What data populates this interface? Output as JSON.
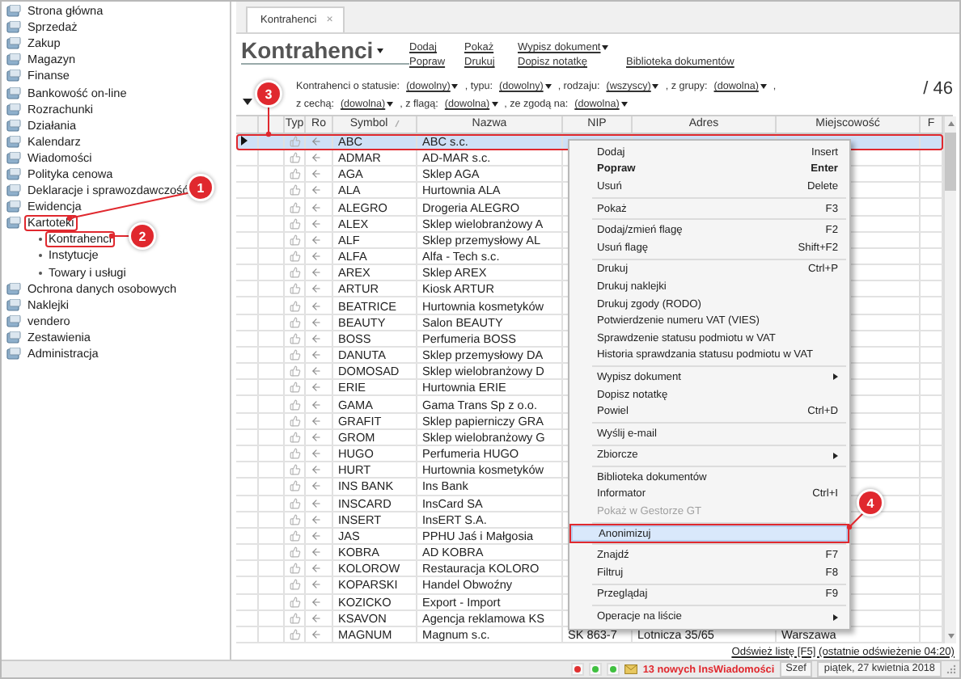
{
  "sidebar": {
    "items": [
      {
        "label": "Strona główna",
        "marked": false
      },
      {
        "label": "Sprzedaż",
        "marked": false
      },
      {
        "label": "Zakup",
        "marked": false
      },
      {
        "label": "Magazyn",
        "marked": false
      },
      {
        "label": "Finanse",
        "marked": false
      },
      {
        "label": "Bankowość on-line",
        "marked": false
      },
      {
        "label": "Rozrachunki",
        "marked": false
      },
      {
        "label": "Działania",
        "marked": false
      },
      {
        "label": "Kalendarz",
        "marked": false
      },
      {
        "label": "Wiadomości",
        "marked": false
      },
      {
        "label": "Polityka cenowa",
        "marked": false
      },
      {
        "label": "Deklaracje i sprawozdawczość",
        "marked": false
      },
      {
        "label": "Ewidencja",
        "marked": false
      },
      {
        "label": "Kartoteki",
        "marked": true,
        "expanded": true,
        "children": [
          {
            "label": "Kontrahenci",
            "marked": true
          },
          {
            "label": "Instytucje",
            "marked": false
          },
          {
            "label": "Towary i usługi",
            "marked": false
          }
        ]
      },
      {
        "label": "Ochrona danych osobowych",
        "marked": false
      },
      {
        "label": "Naklejki",
        "marked": false
      },
      {
        "label": "vendero",
        "marked": false
      },
      {
        "label": "Zestawienia",
        "marked": false
      },
      {
        "label": "Administracja",
        "marked": false
      }
    ]
  },
  "tab": {
    "label": "Kontrahenci",
    "close": "×"
  },
  "header": {
    "title": "Kontrahenci",
    "links": [
      {
        "label": "Dodaj",
        "dropdown": false
      },
      {
        "label": "Popraw",
        "dropdown": false
      },
      {
        "label": "Pokaż",
        "dropdown": false
      },
      {
        "label": "Drukuj",
        "dropdown": false
      },
      {
        "label": "Wypisz dokument",
        "dropdown": true
      },
      {
        "label": "Dopisz notatkę",
        "dropdown": false
      },
      {
        "label": "Biblioteka dokumentów",
        "dropdown": false
      }
    ]
  },
  "filters": [
    [
      {
        "text": "Kontrahenci o statusie:",
        "value": "(dowolny)"
      },
      {
        "text": ", typu:",
        "value": "(dowolny)"
      },
      {
        "text": ", rodzaju:",
        "value": "(wszyscy)"
      },
      {
        "text": ", z grupy:",
        "value": "(dowolna)"
      },
      {
        "text": ","
      }
    ],
    [
      {
        "text": "z cechą:",
        "value": "(dowolna)"
      },
      {
        "text": ", z flagą:",
        "value": "(dowolna)"
      },
      {
        "text": ", ze zgodą na:",
        "value": "(dowolna)"
      }
    ]
  ],
  "count": "/ 46",
  "table": {
    "columns": [
      "",
      "",
      "Typ",
      "Ro",
      "Symbol",
      "Nazwa",
      "NIP",
      "Adres",
      "Miejscowość",
      "F"
    ],
    "rows": [
      {
        "symbol": "ABC",
        "name": "ABC s.c.",
        "selected": true,
        "marked": true
      },
      {
        "symbol": "ADMAR",
        "name": "AD-MAR s.c.",
        "selected": false,
        "marked": false
      },
      {
        "symbol": "AGA",
        "name": "Sklep AGA",
        "selected": false,
        "marked": false
      },
      {
        "symbol": "ALA",
        "name": "Hurtownia ALA",
        "selected": false,
        "marked": false
      },
      {
        "symbol": "ALEGRO",
        "name": "Drogeria ALEGRO",
        "selected": false,
        "marked": false
      },
      {
        "symbol": "ALEX",
        "name": "Sklep wielobranżowy  A",
        "selected": false,
        "marked": false
      },
      {
        "symbol": "ALF",
        "name": "Sklep przemysłowy AL",
        "selected": false,
        "marked": false
      },
      {
        "symbol": "ALFA",
        "name": "Alfa - Tech s.c.",
        "selected": false,
        "marked": false
      },
      {
        "symbol": "AREX",
        "name": "Sklep AREX",
        "selected": false,
        "marked": false
      },
      {
        "symbol": "ARTUR",
        "name": "Kiosk ARTUR",
        "selected": false,
        "marked": false
      },
      {
        "symbol": "BEATRICE",
        "name": "Hurtownia kosmetyków",
        "selected": false,
        "marked": false
      },
      {
        "symbol": "BEAUTY",
        "name": "Salon BEAUTY",
        "selected": false,
        "marked": false
      },
      {
        "symbol": "BOSS",
        "name": "Perfumeria BOSS",
        "selected": false,
        "marked": false
      },
      {
        "symbol": "DANUTA",
        "name": "Sklep przemysłowy DA",
        "selected": false,
        "marked": false
      },
      {
        "symbol": "DOMOSAD",
        "name": "Sklep wielobranżowy D",
        "selected": false,
        "marked": false
      },
      {
        "symbol": "ERIE",
        "name": "Hurtownia ERIE",
        "selected": false,
        "marked": false
      },
      {
        "symbol": "GAMA",
        "name": "Gama Trans Sp z o.o.",
        "selected": false,
        "marked": false
      },
      {
        "symbol": "GRAFIT",
        "name": "Sklep papierniczy GRA",
        "selected": false,
        "marked": false
      },
      {
        "symbol": "GROM",
        "name": "Sklep wielobranżowy G",
        "selected": false,
        "marked": false
      },
      {
        "symbol": "HUGO",
        "name": "Perfumeria HUGO",
        "selected": false,
        "marked": false
      },
      {
        "symbol": "HURT",
        "name": "Hurtownia kosmetyków",
        "selected": false,
        "marked": false
      },
      {
        "symbol": "INS BANK",
        "name": "Ins Bank",
        "selected": false,
        "marked": false
      },
      {
        "symbol": "INSCARD",
        "name": "InsCard SA",
        "selected": false,
        "marked": false
      },
      {
        "symbol": "INSERT",
        "name": "InsERT S.A.",
        "selected": false,
        "marked": false
      },
      {
        "symbol": "JAS",
        "name": "PPHU Jaś i Małgosia",
        "selected": false,
        "marked": false
      },
      {
        "symbol": "KOBRA",
        "name": "AD KOBRA",
        "selected": false,
        "marked": false
      },
      {
        "symbol": "KOLOROW",
        "name": "Restauracja KOLORO",
        "selected": false,
        "marked": false
      },
      {
        "symbol": "KOPARSKI",
        "name": "Handel Obwoźny",
        "selected": false,
        "marked": false
      },
      {
        "symbol": "KOZICKO",
        "name": "Export - Import",
        "selected": false,
        "marked": false
      },
      {
        "symbol": "KSAVON",
        "name": "Agencja reklamowa KS",
        "selected": false,
        "marked": false
      },
      {
        "symbol": "MAGNUM",
        "name": "Magnum s.c.",
        "nip": "SK 863-7",
        "address": "Lotnicza  35/65",
        "city": "Warszawa",
        "selected": false,
        "marked": false
      }
    ]
  },
  "context_menu": [
    {
      "kind": "item",
      "label": "Dodaj",
      "shortcut": "Insert",
      "default": false,
      "disabled": false,
      "submenu": false,
      "highlighted": false,
      "marked": false
    },
    {
      "kind": "item",
      "label": "Popraw",
      "shortcut": "Enter",
      "default": true,
      "disabled": false,
      "submenu": false,
      "highlighted": false,
      "marked": false
    },
    {
      "kind": "item",
      "label": "Usuń",
      "shortcut": "Delete",
      "default": false,
      "disabled": false,
      "submenu": false,
      "highlighted": false,
      "marked": false
    },
    {
      "kind": "separator"
    },
    {
      "kind": "item",
      "label": "Pokaż",
      "shortcut": "F3",
      "default": false,
      "disabled": false,
      "submenu": false,
      "highlighted": false,
      "marked": false
    },
    {
      "kind": "separator"
    },
    {
      "kind": "item",
      "label": "Dodaj/zmień flagę",
      "shortcut": "F2",
      "default": false,
      "disabled": false,
      "submenu": false,
      "highlighted": false,
      "marked": false
    },
    {
      "kind": "item",
      "label": "Usuń flagę",
      "shortcut": "Shift+F2",
      "default": false,
      "disabled": false,
      "submenu": false,
      "highlighted": false,
      "marked": false
    },
    {
      "kind": "separator"
    },
    {
      "kind": "item",
      "label": "Drukuj",
      "shortcut": "Ctrl+P",
      "default": false,
      "disabled": false,
      "submenu": false,
      "highlighted": false,
      "marked": false
    },
    {
      "kind": "item",
      "label": "Drukuj naklejki",
      "default": false,
      "disabled": false,
      "submenu": false,
      "highlighted": false,
      "marked": false
    },
    {
      "kind": "item",
      "label": "Drukuj zgody (RODO)",
      "default": false,
      "disabled": false,
      "submenu": false,
      "highlighted": false,
      "marked": false
    },
    {
      "kind": "item",
      "label": "Potwierdzenie numeru VAT (VIES)",
      "default": false,
      "disabled": false,
      "submenu": false,
      "highlighted": false,
      "marked": false
    },
    {
      "kind": "item",
      "label": "Sprawdzenie statusu podmiotu w VAT",
      "default": false,
      "disabled": false,
      "submenu": false,
      "highlighted": false,
      "marked": false
    },
    {
      "kind": "item",
      "label": "Historia sprawdzania statusu podmiotu w VAT",
      "default": false,
      "disabled": false,
      "submenu": false,
      "highlighted": false,
      "marked": false
    },
    {
      "kind": "separator"
    },
    {
      "kind": "item",
      "label": "Wypisz dokument",
      "default": false,
      "disabled": false,
      "submenu": true,
      "highlighted": false,
      "marked": false
    },
    {
      "kind": "item",
      "label": "Dopisz notatkę",
      "default": false,
      "disabled": false,
      "submenu": false,
      "highlighted": false,
      "marked": false
    },
    {
      "kind": "item",
      "label": "Powiel",
      "shortcut": "Ctrl+D",
      "default": false,
      "disabled": false,
      "submenu": false,
      "highlighted": false,
      "marked": false
    },
    {
      "kind": "separator"
    },
    {
      "kind": "item",
      "label": "Wyślij e-mail",
      "default": false,
      "disabled": false,
      "submenu": false,
      "highlighted": false,
      "marked": false
    },
    {
      "kind": "separator"
    },
    {
      "kind": "item",
      "label": "Zbiorcze",
      "default": false,
      "disabled": false,
      "submenu": true,
      "highlighted": false,
      "marked": false
    },
    {
      "kind": "separator"
    },
    {
      "kind": "item",
      "label": "Biblioteka dokumentów",
      "default": false,
      "disabled": false,
      "submenu": false,
      "highlighted": false,
      "marked": false
    },
    {
      "kind": "item",
      "label": "Informator",
      "shortcut": "Ctrl+I",
      "default": false,
      "disabled": false,
      "submenu": false,
      "highlighted": false,
      "marked": false
    },
    {
      "kind": "item",
      "label": "Pokaż w Gestorze GT",
      "default": false,
      "disabled": true,
      "submenu": false,
      "highlighted": false,
      "marked": false
    },
    {
      "kind": "separator"
    },
    {
      "kind": "item",
      "label": "Anonimizuj",
      "default": false,
      "disabled": false,
      "submenu": false,
      "highlighted": true,
      "marked": true
    },
    {
      "kind": "separator"
    },
    {
      "kind": "item",
      "label": "Znajdź",
      "shortcut": "F7",
      "default": false,
      "disabled": false,
      "submenu": false,
      "highlighted": false,
      "marked": false
    },
    {
      "kind": "item",
      "label": "Filtruj",
      "shortcut": "F8",
      "default": false,
      "disabled": false,
      "submenu": false,
      "highlighted": false,
      "marked": false
    },
    {
      "kind": "separator"
    },
    {
      "kind": "item",
      "label": "Przeglądaj",
      "shortcut": "F9",
      "default": false,
      "disabled": false,
      "submenu": false,
      "highlighted": false,
      "marked": false
    },
    {
      "kind": "separator"
    },
    {
      "kind": "item",
      "label": "Operacje na liście",
      "default": false,
      "disabled": false,
      "submenu": true,
      "highlighted": false,
      "marked": false
    }
  ],
  "refresh_link": "Odśwież listę [F5] (ostatnie odświeżenie 04:20)",
  "status_bar": {
    "lights": [
      {
        "color": "#e03030"
      },
      {
        "color": "#40c040"
      },
      {
        "color": "#40c040"
      }
    ],
    "messages": "13 nowych InsWiadomości",
    "user": "Szef",
    "date": "piątek, 27 kwietnia 2018"
  },
  "annotations": [
    {
      "label": "1"
    },
    {
      "label": "2"
    },
    {
      "label": "3"
    },
    {
      "label": "4"
    }
  ]
}
